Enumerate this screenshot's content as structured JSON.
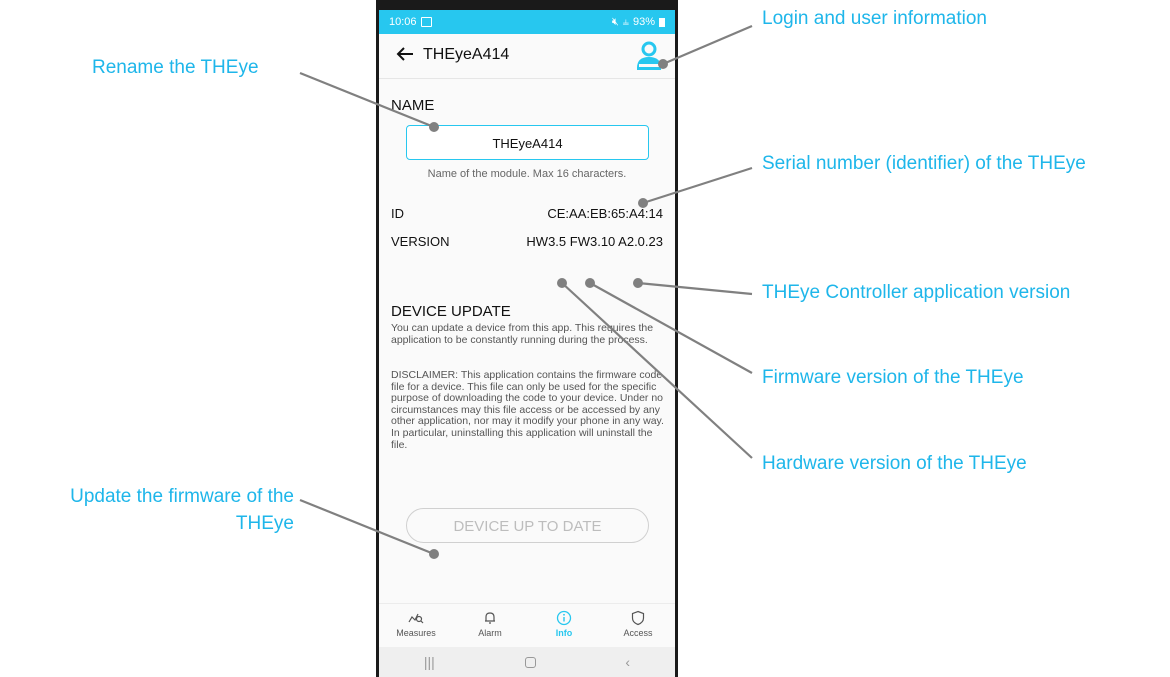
{
  "status_bar": {
    "time": "10:06",
    "battery": "93%"
  },
  "app_bar": {
    "title": "THEyeA414"
  },
  "name_section": {
    "heading": "NAME",
    "value": "THEyeA414",
    "helper": "Name of the module. Max 16 characters."
  },
  "info": {
    "id_label": "ID",
    "id_value": "CE:AA:EB:65:A4:14",
    "version_label": "VERSION",
    "version_value": "HW3.5 FW3.10 A2.0.23"
  },
  "update_section": {
    "heading": "DEVICE UPDATE",
    "text1": "You can update a device from this app. This requires the application to be constantly running during the process.",
    "text2": "DISCLAIMER: This application contains the firmware code file for a device. This file can only be used for the specific purpose of downloading the code to your device. Under no circumstances may this file access or be accessed by any other application, nor may it modify your phone in any way. In particular, uninstalling this application will uninstall the file.",
    "button_label": "DEVICE UP TO DATE"
  },
  "bottom_nav": {
    "items": [
      {
        "label": "Measures",
        "icon": "measures-icon"
      },
      {
        "label": "Alarm",
        "icon": "bell-icon"
      },
      {
        "label": "Info",
        "icon": "info-icon",
        "active": true
      },
      {
        "label": "Access",
        "icon": "shield-icon"
      }
    ]
  },
  "callouts": {
    "login": "Login and user information",
    "rename": "Rename the THEye",
    "serial": "Serial number (identifier) of the THEye",
    "app_version": "THEye Controller application version",
    "firmware": "Firmware version of the THEye",
    "hardware": "Hardware version of the THEye",
    "update_line1": "Update the firmware of the",
    "update_line2": "THEye"
  },
  "colors": {
    "accent": "#27c7ef",
    "callout": "#1eb6ea",
    "pointer": "#808080"
  }
}
